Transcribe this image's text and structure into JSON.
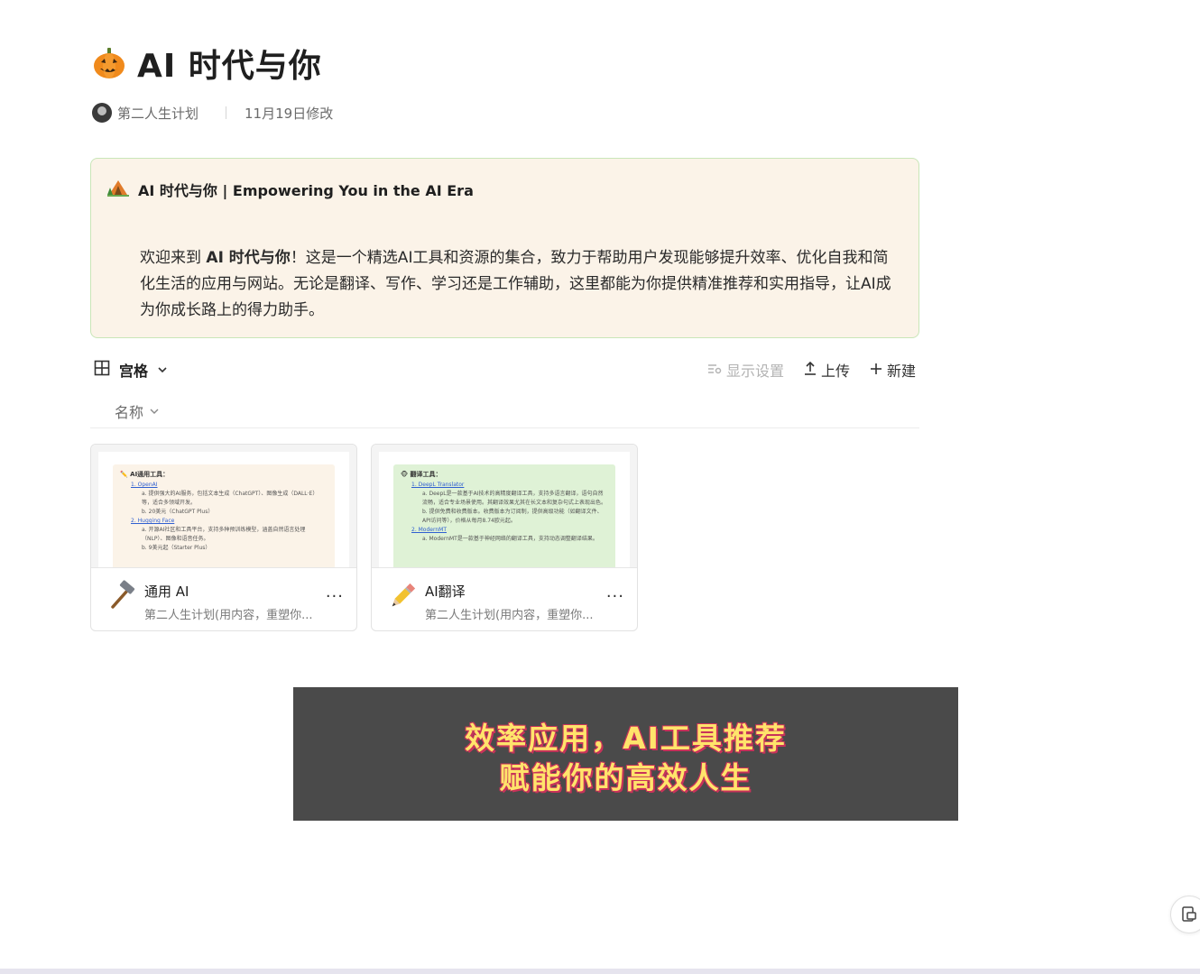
{
  "page": {
    "title": "AI 时代与你",
    "author": "第二人生计划",
    "modified": "11月19日修改"
  },
  "callout": {
    "title": "AI 时代与你 | Empowering You in the AI Era",
    "body_before": "欢迎来到 ",
    "body_bold": "AI 时代与你",
    "body_after": "！这是一个精选AI工具和资源的集合，致力于帮助用户发现能够提升效率、优化自我和简化生活的应用与网站。无论是翻译、写作、学习还是工作辅助，这里都能为你提供精准推荐和实用指导，让AI成为你成长路上的得力助手。"
  },
  "toolbar": {
    "view_label": "宫格",
    "display_settings": "显示设置",
    "upload": "上传",
    "new": "新建",
    "sort_label": "名称"
  },
  "cards": [
    {
      "title": "通用 AI",
      "subtitle": "第二人生计划(用内容，重塑你...",
      "icon": "hammer-icon",
      "preview_bg": "#fbf3e8",
      "preview": {
        "heading": "✏️ AI通用工具：",
        "items": [
          "1. OpenAI",
          "a. 提供强大的AI服务，包括文本生成（ChatGPT）、图像生成（DALL·E）等，适合多领域开发。",
          "b. 20美元（ChatGPT Plus）",
          "2. Hugging Face",
          "a. 开源AI社区和工具平台，支持多种预训练模型，涵盖自然语言处理（NLP）、图像和语音任务。",
          "b. 9美元起（Starter Plus）"
        ]
      }
    },
    {
      "title": "AI翻译",
      "subtitle": "第二人生计划(用内容，重塑你...",
      "icon": "pencil-icon",
      "preview_bg": "#dff2d6",
      "preview": {
        "heading": "🐵 翻译工具：",
        "items": [
          "1. DeepL Translator",
          "a. DeepL是一款基于AI技术的高精度翻译工具，支持多语言翻译，语句自然流畅，适合专业场景使用。其翻译效果尤其在长文本和复杂句式上表现出色。",
          "b. 提供免费和收费版本。收费版本为订阅制，提供高级功能（如翻译文件、API访问等），价格从每月8.74欧元起。",
          "2. ModernMT",
          "a. ModernMT是一款基于神经网络的翻译工具，支持动态调整翻译结果。"
        ]
      }
    }
  ],
  "banner": {
    "line1": "效率应用，AI工具推荐",
    "line2": "赋能你的高效人生"
  }
}
